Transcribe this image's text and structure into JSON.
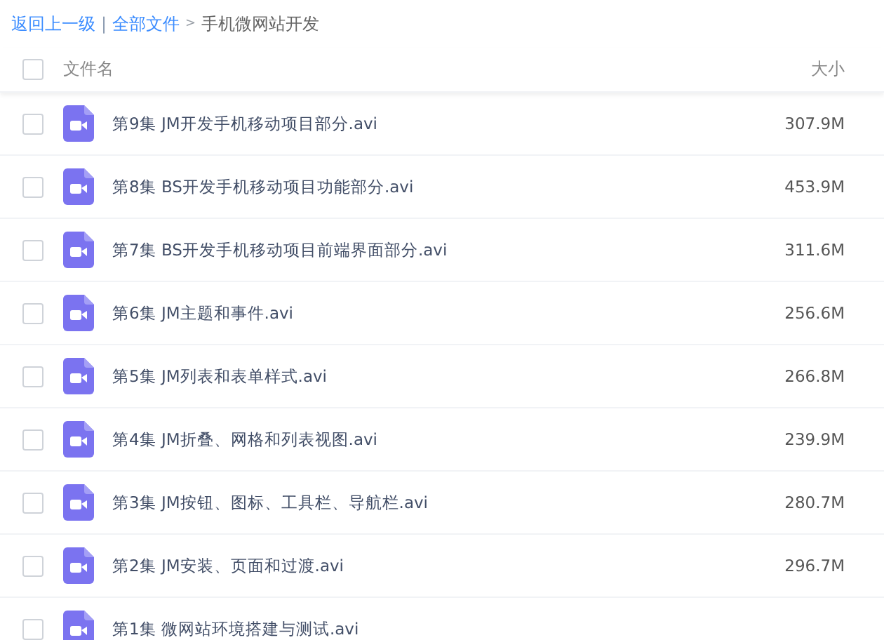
{
  "breadcrumb": {
    "back": "返回上一级",
    "separator": "|",
    "root": "全部文件",
    "arrow": ">",
    "current": "手机微网站开发"
  },
  "table": {
    "columns": [
      "文件名",
      "大小"
    ],
    "header_checked": false,
    "rows": [
      {
        "name": "第9集 JM开发手机移动项目部分.avi",
        "size": "307.9M",
        "checked": false
      },
      {
        "name": "第8集 BS开发手机移动项目功能部分.avi",
        "size": "453.9M",
        "checked": false
      },
      {
        "name": "第7集 BS开发手机移动项目前端界面部分.avi",
        "size": "311.6M",
        "checked": false
      },
      {
        "name": "第6集 JM主题和事件.avi",
        "size": "256.6M",
        "checked": false
      },
      {
        "name": "第5集 JM列表和表单样式.avi",
        "size": "266.8M",
        "checked": false
      },
      {
        "name": "第4集 JM折叠、网格和列表视图.avi",
        "size": "239.9M",
        "checked": false
      },
      {
        "name": "第3集 JM按钮、图标、工具栏、导航栏.avi",
        "size": "280.7M",
        "checked": false
      },
      {
        "name": "第2集 JM安装、页面和过渡.avi",
        "size": "296.7M",
        "checked": false
      },
      {
        "name": "第1集 微网站环境搭建与测试.avi",
        "checked": false
      }
    ]
  }
}
